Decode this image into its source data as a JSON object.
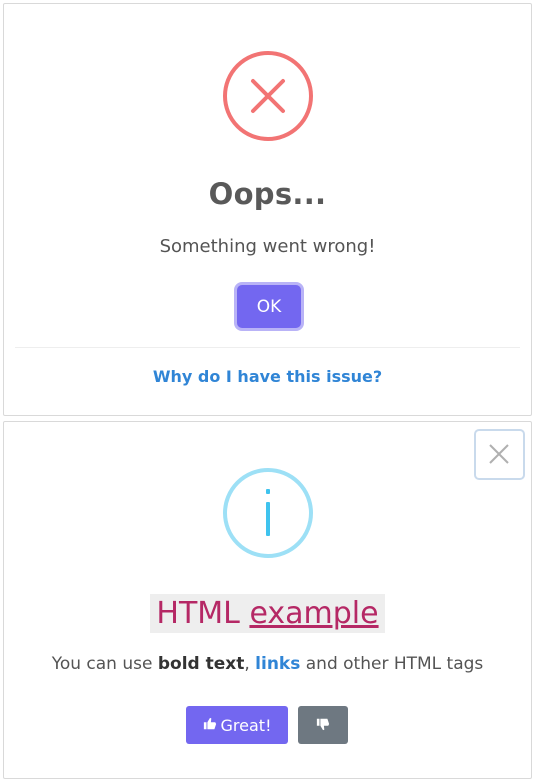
{
  "dialog_error": {
    "icon": "error-x-icon",
    "title": "Oops...",
    "text": "Something went wrong!",
    "confirm_label": "OK",
    "footer_link": "Why do I have this issue?",
    "colors": {
      "icon": "#f27474",
      "confirm": "#7367f0",
      "link": "#3085d6"
    }
  },
  "dialog_info": {
    "icon": "info-i-icon",
    "close_icon": "close-x-icon",
    "title_prefix": "HTML",
    "title_link": "example",
    "text_before": "You can use",
    "text_bold": "bold text",
    "text_comma": ",",
    "text_link": "links",
    "text_after": "and other HTML tags",
    "confirm_label": "Great!",
    "confirm_icon": "thumbs-up-icon",
    "cancel_icon": "thumbs-down-icon",
    "colors": {
      "icon": "#3fc3ee",
      "title": "#b52865",
      "confirm": "#7367f0",
      "cancel": "#6e7881"
    }
  }
}
